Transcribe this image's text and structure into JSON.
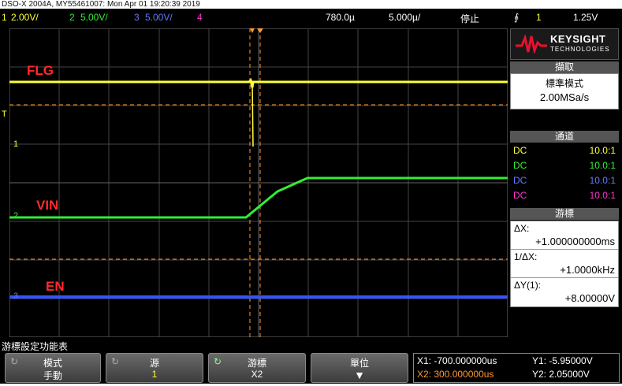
{
  "window": {
    "title": "DSO-X 2004A, MY55461007: Mon Apr 01 19:20:39 2019"
  },
  "status_bar": {
    "ch1_num": "1",
    "ch1_scale": "2.00V/",
    "ch2_num": "2",
    "ch2_scale": "5.00V/",
    "ch3_num": "3",
    "ch3_scale": "5.00V/",
    "ch4_num": "4",
    "time_delay": "780.0µ",
    "time_scale": "5.000µ/",
    "run_state": "停止",
    "trigger_icon": "⨙",
    "trigger_source": "1",
    "trigger_level": "1.25V"
  },
  "traces": {
    "flg_label": "FLG",
    "vin_label": "VIN",
    "en_label": "EN",
    "ch1_marker": "1",
    "ch2_marker": "2",
    "ch3_marker": "3",
    "trig_marker": "T",
    "colors": {
      "ch1": "#ffff33",
      "ch2": "#33ee33",
      "ch3": "#3355ff",
      "ch4": "#ff33cc",
      "cursor": "#ff9933",
      "label": "#ff2a2a"
    }
  },
  "side_panel": {
    "brand": "KEYSIGHT",
    "brand_sub": "TECHNOLOGIES",
    "acquire": {
      "header": "擷取",
      "mode": "標準模式",
      "rate": "2.00MSa/s"
    },
    "channels": {
      "header": "通道",
      "rows": [
        {
          "coupling": "DC",
          "probe": "10.0:1"
        },
        {
          "coupling": "DC",
          "probe": "10.0:1"
        },
        {
          "coupling": "DC",
          "probe": "10.0:1"
        },
        {
          "coupling": "DC",
          "probe": "10.0:1"
        }
      ]
    },
    "cursors": {
      "header": "游標",
      "dx_label": "ΔX:",
      "dx_value": "+1.000000000ms",
      "inv_label": "1/ΔX:",
      "inv_value": "+1.0000kHz",
      "dy_label": "ΔY(1):",
      "dy_value": "+8.00000V"
    }
  },
  "softkeys": {
    "menu_title": "游標設定功能表",
    "mode": {
      "label": "模式",
      "value": "手動"
    },
    "source": {
      "label": "源",
      "value": "1"
    },
    "cursor": {
      "label": "游標",
      "value": "X2"
    },
    "units": {
      "label": "單位"
    },
    "readout": {
      "x1": "X1: -700.000000us",
      "x2": "X2: 300.000000us",
      "y1": "Y1: -5.95000V",
      "y2": "Y2: 2.05000V"
    }
  }
}
